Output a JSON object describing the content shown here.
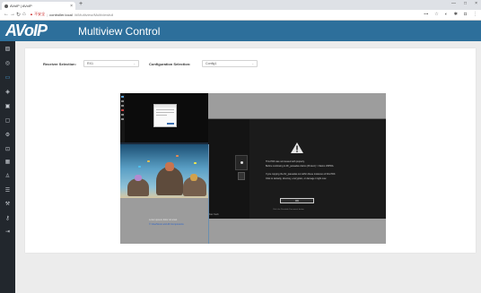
{
  "browser": {
    "tab_title": "AVoIP | AVoIP",
    "tab_close": "×",
    "new_tab": "+",
    "window_controls": [
      "—",
      "□",
      "×"
    ],
    "nav": {
      "back": "←",
      "forward": "→",
      "reload": "↻",
      "home": "⌂"
    },
    "url": {
      "security": "▲ 不安全",
      "host": "controller.local",
      "path": "/#/Multiview/Multiviewfull"
    },
    "extensions": [
      "⊶",
      "☆",
      "◐",
      "✱",
      "◘",
      "⋮"
    ]
  },
  "header": {
    "logo": "AVoIP",
    "title": "Multiview Control"
  },
  "sidebar": {
    "items": [
      {
        "name": "dashboard-icon",
        "glyph": "▨",
        "active": false
      },
      {
        "name": "globe-icon",
        "glyph": "◎",
        "active": false
      },
      {
        "name": "multiview-icon",
        "glyph": "▭",
        "active": true
      },
      {
        "name": "layers-icon",
        "glyph": "◈",
        "active": false
      },
      {
        "name": "monitor-icon",
        "glyph": "▣",
        "active": false
      },
      {
        "name": "screen-icon",
        "glyph": "▢",
        "active": false
      },
      {
        "name": "settings-icon",
        "glyph": "⚙",
        "active": false
      },
      {
        "name": "network-icon",
        "glyph": "⊡",
        "active": false
      },
      {
        "name": "grid-icon",
        "glyph": "▦",
        "active": false
      },
      {
        "name": "user-icon",
        "glyph": "♙",
        "active": false
      },
      {
        "name": "list-icon",
        "glyph": "☰",
        "active": false
      },
      {
        "name": "tools-icon",
        "glyph": "⚒",
        "active": false
      },
      {
        "name": "key-icon",
        "glyph": "⚷",
        "active": false
      },
      {
        "name": "logout-icon",
        "glyph": "⇥",
        "active": false
      }
    ]
  },
  "controls": {
    "receiver_label": "Receiver Selection:",
    "receiver_value": "RX1",
    "config_label": "Configuration Selection:",
    "config_value": "Config1"
  },
  "preview": {
    "bottom_left_line1": "Lorem ipsum dolor sit amet",
    "bottom_left_line2": "© ViewSonic and All Components",
    "right_pane": {
      "line1": "This PDF was not viewed with properly.",
      "line2": "Before continuing to Mr_pareadas claims (Protect) > Claims VRPRA",
      "line3": "If you copying the AV_pareadas out within these instances of this PDF.",
      "line4": "Click to defaulty, directory, encryption, or damage it right now.",
      "button": "OK",
      "footer": "Click the Printable Document button",
      "corner": "Fax: fresh"
    }
  }
}
